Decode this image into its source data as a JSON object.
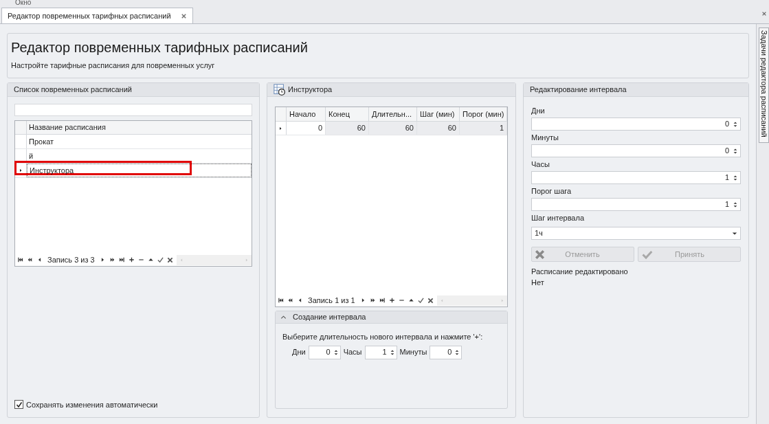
{
  "menu": {
    "label": "Окно"
  },
  "document_tabs": [
    {
      "label": "Редактор повременных тарифных расписаний",
      "selected": true
    }
  ],
  "side_tab": {
    "label": "Задачи редактора расписаний"
  },
  "header": {
    "title": "Редактор повременных тарифных расписаний",
    "subtitle": "Настройте тарифные расписания для повременных услуг"
  },
  "schedule_list": {
    "title": "Список повременных расписаний",
    "columns": [
      "Название расписания"
    ],
    "rows": [
      {
        "name": "Прокат",
        "selected": false,
        "annotated": false
      },
      {
        "name": "й",
        "selected": false,
        "annotated": false
      },
      {
        "name": "Инструктора",
        "selected": true,
        "annotated": true
      }
    ],
    "navigator": {
      "record_text": "Запись 3 из 3"
    },
    "autosave": {
      "label": "Сохранять изменения автоматически",
      "checked": true
    }
  },
  "intervals": {
    "title": "Инструктора",
    "columns": [
      "Начало",
      "Конец",
      "Длительн...",
      "Шаг (мин)",
      "Порог (мин)"
    ],
    "rows": [
      {
        "cells": [
          "0",
          "60",
          "60",
          "60",
          "1"
        ],
        "selected": true
      }
    ],
    "navigator": {
      "record_text": "Запись 1 из 1"
    }
  },
  "create_interval": {
    "title": "Создание интервала",
    "expanded": true,
    "hint": "Выберите длительность нового интервала и нажмите '+':",
    "fields": [
      {
        "label": "Дни",
        "value": "0"
      },
      {
        "label": "Часы",
        "value": "1"
      },
      {
        "label": "Минуты",
        "value": "0"
      }
    ]
  },
  "edit_interval": {
    "title": "Редактирование интервала",
    "fields": [
      {
        "label": "Дни",
        "value": "0",
        "kind": "spin"
      },
      {
        "label": "Минуты",
        "value": "0",
        "kind": "spin"
      },
      {
        "label": "Часы",
        "value": "1",
        "kind": "spin"
      },
      {
        "label": "Порог шага",
        "value": "1",
        "kind": "spin"
      },
      {
        "label": "Шаг интервала",
        "value": "1ч",
        "kind": "dropdown"
      }
    ],
    "buttons": [
      {
        "label": "Отменить",
        "kind": "cancel",
        "disabled": true
      },
      {
        "label": "Принять",
        "kind": "accept",
        "disabled": true
      }
    ],
    "status_label": "Расписание редактировано",
    "status_value": "Нет"
  }
}
